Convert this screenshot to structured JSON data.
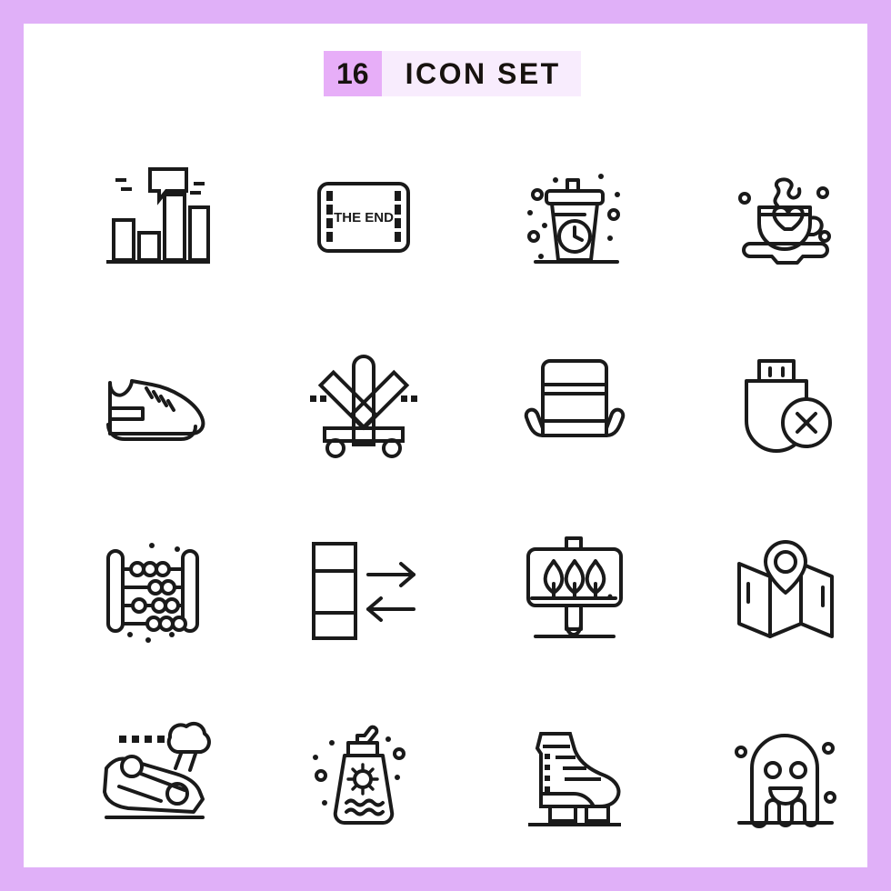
{
  "header": {
    "count_badge": "16",
    "title": "ICON SET",
    "badge_color": "#e7aef8",
    "title_bg_color": "#f8ecfd",
    "text_color": "#17120f"
  },
  "theme": {
    "frame_color": "#e0b0f8",
    "panel_color": "#ffffff",
    "icon_stroke_color": "#1a1a1a"
  },
  "grid": {
    "columns": 4,
    "rows": 4,
    "total_icons": 16
  },
  "icons": [
    {
      "index": 1,
      "name": "bar-chart-comment-icon",
      "label": "Bar chart with speech bubble",
      "row": 1,
      "col": 1
    },
    {
      "index": 2,
      "name": "film-the-end-icon",
      "label": "THE END film frame",
      "row": 1,
      "col": 2,
      "text": "THE END"
    },
    {
      "index": 3,
      "name": "coffee-cup-clock-icon",
      "label": "Takeaway coffee cup with clock",
      "row": 1,
      "col": 3
    },
    {
      "index": 4,
      "name": "tea-cup-heart-icon",
      "label": "Hot tea cup with heart",
      "row": 1,
      "col": 4
    },
    {
      "index": 5,
      "name": "sneaker-shoe-icon",
      "label": "Sneaker shoe",
      "row": 2,
      "col": 1
    },
    {
      "index": 6,
      "name": "railroad-crossing-sign-icon",
      "label": "Railroad crossing sign",
      "row": 2,
      "col": 2
    },
    {
      "index": 7,
      "name": "sled-icon",
      "label": "Sled",
      "row": 2,
      "col": 3
    },
    {
      "index": 8,
      "name": "usb-remove-icon",
      "label": "USB drive with remove badge",
      "row": 2,
      "col": 4
    },
    {
      "index": 9,
      "name": "abacus-icon",
      "label": "Abacus",
      "row": 3,
      "col": 1
    },
    {
      "index": 10,
      "name": "data-transfer-server-icon",
      "label": "Server data transfer arrows",
      "row": 3,
      "col": 2
    },
    {
      "index": 11,
      "name": "park-billboard-sign-icon",
      "label": "Billboard sign with trees",
      "row": 3,
      "col": 3
    },
    {
      "index": 12,
      "name": "map-location-pin-icon",
      "label": "Folded map with location pin",
      "row": 3,
      "col": 4
    },
    {
      "index": 13,
      "name": "car-crash-icon",
      "label": "Overturned car accident",
      "row": 4,
      "col": 1
    },
    {
      "index": 14,
      "name": "sunscreen-bottle-icon",
      "label": "Sunscreen lotion bottle",
      "row": 4,
      "col": 2
    },
    {
      "index": 15,
      "name": "ice-skate-icon",
      "label": "Ice skate boot",
      "row": 4,
      "col": 3
    },
    {
      "index": 16,
      "name": "ghost-icon",
      "label": "Smiling ghost",
      "row": 4,
      "col": 4
    }
  ]
}
